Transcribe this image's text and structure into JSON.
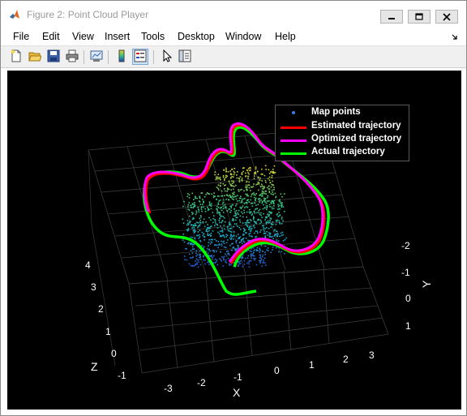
{
  "window": {
    "title": "Figure 2: Point Cloud Player"
  },
  "menu": {
    "items": [
      "File",
      "Edit",
      "View",
      "Insert",
      "Tools",
      "Desktop",
      "Window",
      "Help"
    ]
  },
  "toolbar": {
    "buttons": [
      "new-figure-icon",
      "open-file-icon",
      "save-icon",
      "print-icon",
      "link-plot-icon",
      "colorbar-icon",
      "legend-icon",
      "pointer-icon",
      "property-inspector-icon"
    ]
  },
  "legend": {
    "entries": [
      {
        "label": "Map points",
        "color": "#3a7fe0",
        "style": "marker"
      },
      {
        "label": "Estimated trajectory",
        "color": "#ff0000",
        "style": "line"
      },
      {
        "label": "Optimized trajectory",
        "color": "#ff00ff",
        "style": "line"
      },
      {
        "label": "Actual trajectory",
        "color": "#00ff00",
        "style": "line"
      }
    ]
  },
  "axes": {
    "x_label": "X",
    "y_label": "Y",
    "z_label": "Z",
    "x_ticks": [
      "-3",
      "-2",
      "-1",
      "0",
      "1",
      "2",
      "3"
    ],
    "y_ticks": [
      "-2",
      "-1",
      "0",
      "1"
    ],
    "z_ticks": [
      "-1",
      "0",
      "1",
      "2",
      "3",
      "4"
    ]
  },
  "colors": {
    "background": "#000000",
    "estimated": "#ff0000",
    "optimized": "#ff00ff",
    "actual": "#00ff00"
  }
}
